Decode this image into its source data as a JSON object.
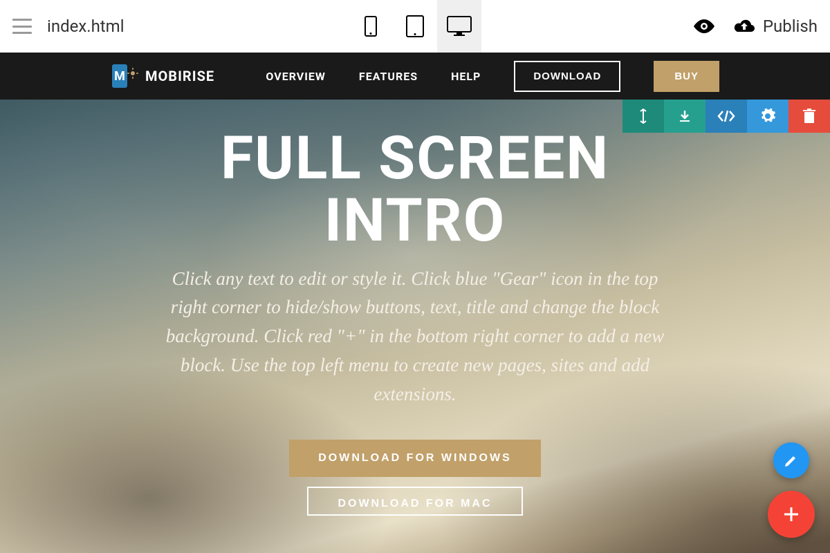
{
  "toolbar": {
    "file_name": "index.html",
    "publish_label": "Publish"
  },
  "site_nav": {
    "brand": "MOBIRISE",
    "links": [
      "OVERVIEW",
      "FEATURES",
      "HELP"
    ],
    "download_label": "DOWNLOAD",
    "buy_label": "BUY"
  },
  "hero": {
    "title_line1": "FULL SCREEN",
    "title_line2": "INTRO",
    "subtitle": "Click any text to edit or style it. Click blue \"Gear\" icon in the top right corner to hide/show buttons, text, title and change the block background. Click red \"+\" in the bottom right corner to add a new block. Use the top left menu to create new pages, sites and add extensions.",
    "button_primary": "DOWNLOAD FOR WINDOWS",
    "button_secondary": "DOWNLOAD FOR MAC"
  }
}
